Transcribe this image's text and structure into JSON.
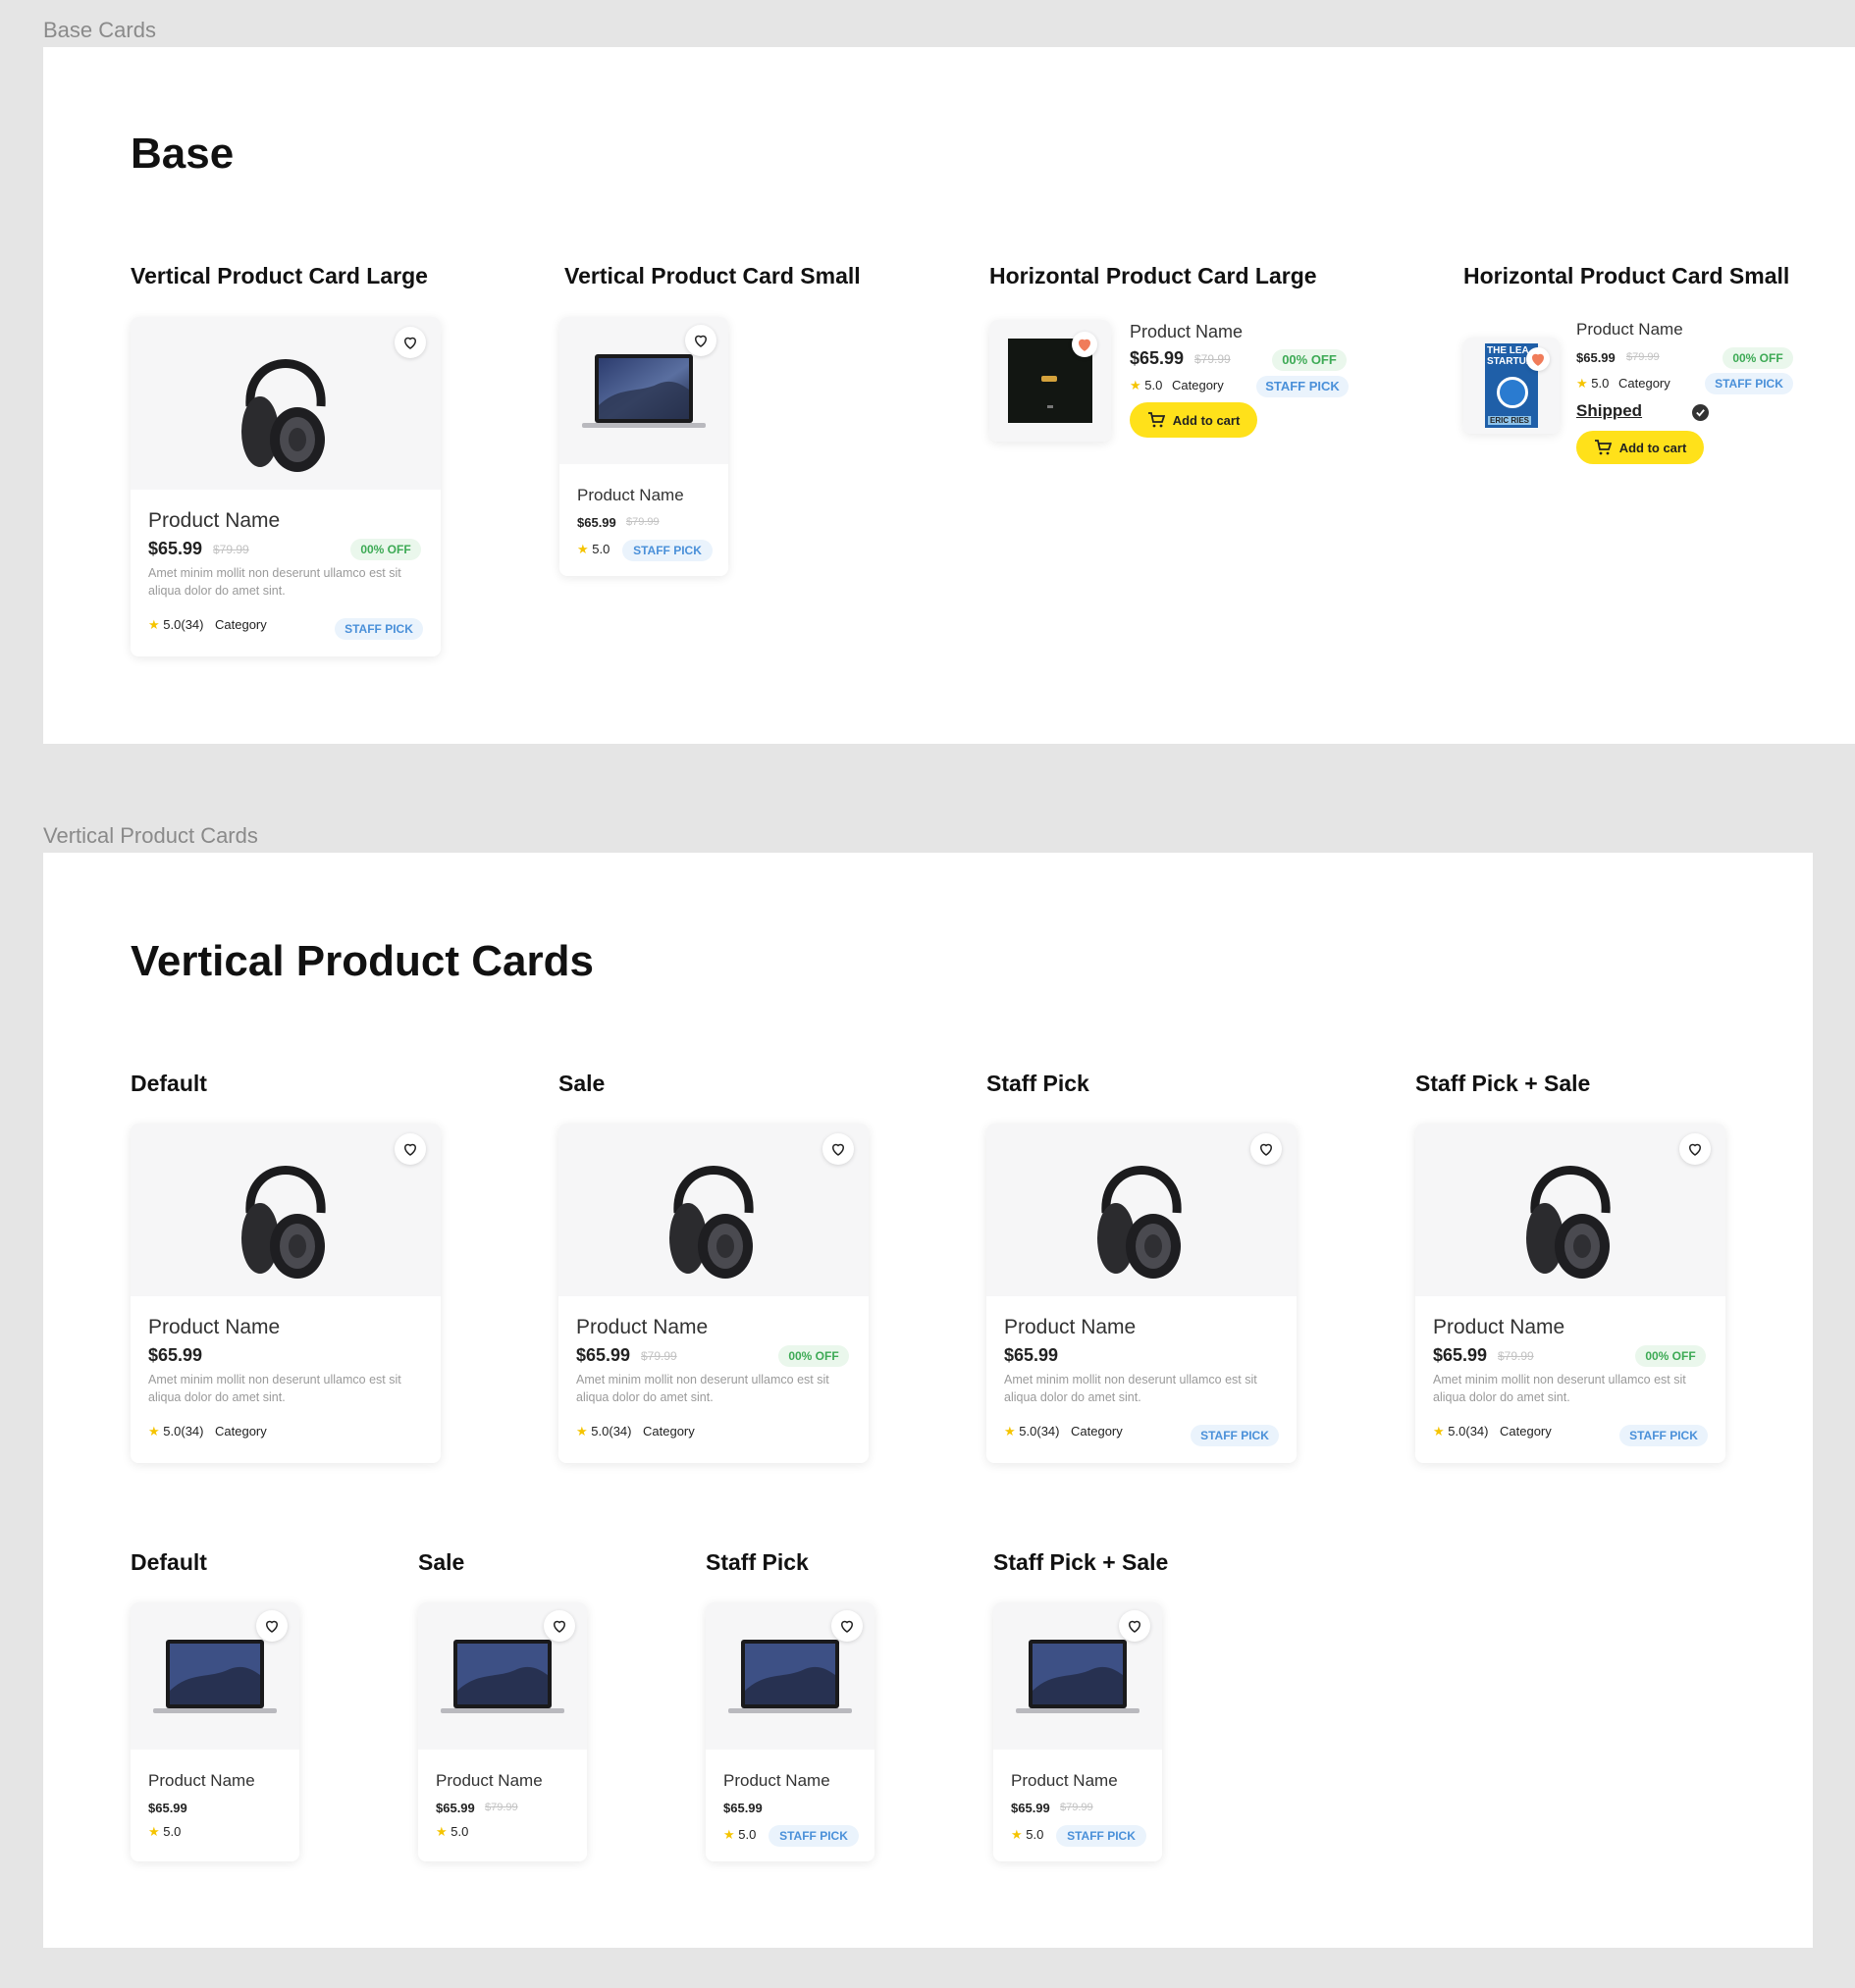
{
  "frames": {
    "base_label": "Base Cards",
    "vertical_label": "Vertical Product Cards"
  },
  "base": {
    "title": "Base",
    "subtitles": [
      "Vertical Product Card Large",
      "Vertical Product Card Small",
      "Horizontal Product Card Large",
      "Horizontal Product Card Small"
    ]
  },
  "vertical": {
    "title": "Vertical Product Cards",
    "row1_subtitles": [
      "Default",
      "Sale",
      "Staff Pick",
      "Staff Pick + Sale"
    ],
    "row2_subtitles": [
      "Default",
      "Sale",
      "Staff Pick",
      "Staff Pick + Sale"
    ]
  },
  "product": {
    "name": "Product Name",
    "price": "$65.99",
    "old_price": "$79.99",
    "discount": "00% OFF",
    "description": "Amet minim mollit non deserunt ullamco est sit aliqua dolor do amet sint.",
    "rating": "5.0",
    "reviews": "(34)",
    "category": "Category",
    "staff_pick": "STAFF PICK",
    "add_to_cart": "Add to cart",
    "shipped": "Shipped",
    "star": "★"
  },
  "book_cover": {
    "line1": "THE LEA",
    "line2": "STARTUP",
    "author": "ERIC RIES"
  },
  "colors": {
    "accent_yellow": "#ffe11a",
    "sale_green": "#3daa55",
    "staff_blue": "#4a90d9",
    "heart_active": "#f07c5a",
    "star": "#f5c400"
  },
  "icons": [
    "heart-icon",
    "star-icon",
    "cart-icon",
    "check-circle-icon",
    "headphones-image",
    "laptop-image",
    "album-cover-image",
    "book-cover-image"
  ]
}
